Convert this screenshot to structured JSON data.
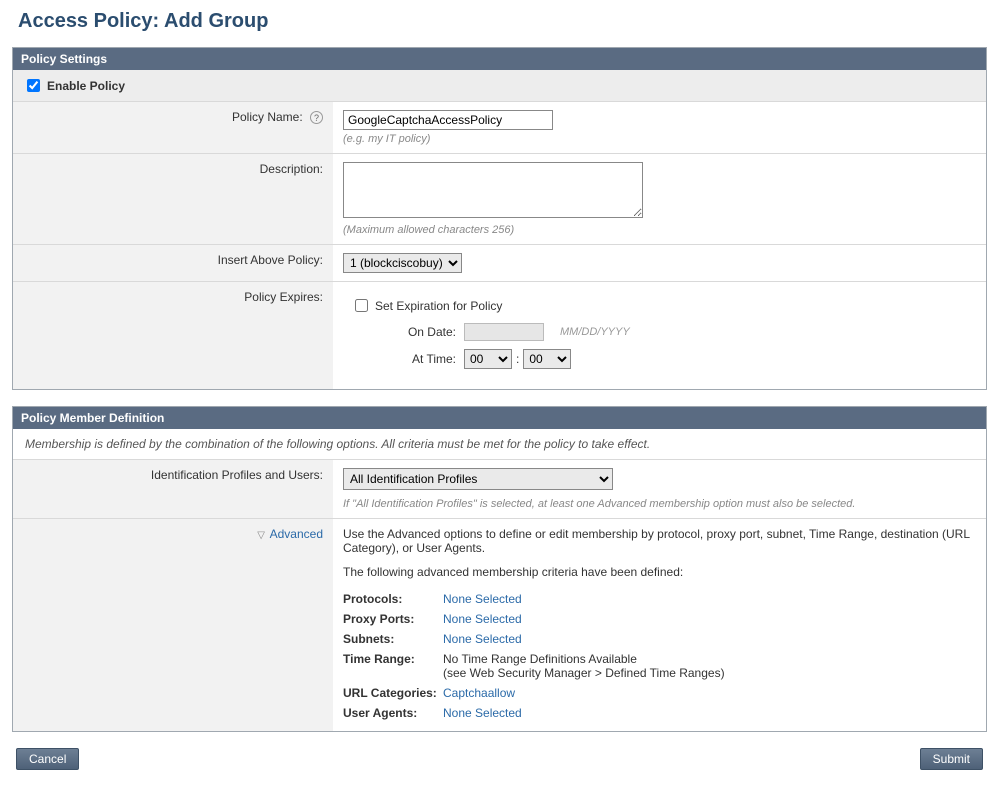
{
  "page": {
    "title": "Access Policy: Add Group"
  },
  "policySettings": {
    "header": "Policy Settings",
    "enablePolicy": {
      "label": "Enable Policy",
      "checked": true
    },
    "policyName": {
      "label": "Policy Name:",
      "value": "GoogleCaptchaAccessPolicy",
      "hint": "(e.g. my IT policy)",
      "helpText": "?"
    },
    "description": {
      "label": "Description:",
      "value": "",
      "hint": "(Maximum allowed characters 256)"
    },
    "insertAbove": {
      "label": "Insert Above Policy:",
      "selected": "1 (blockciscobuy)"
    },
    "expires": {
      "label": "Policy Expires:",
      "setExpirationLabel": "Set Expiration for Policy",
      "setExpirationChecked": false,
      "onDateLabel": "On Date:",
      "dateFormat": "MM/DD/YYYY",
      "atTimeLabel": "At Time:",
      "hour": "00",
      "minute": "00",
      "sep": ":"
    }
  },
  "policyMember": {
    "header": "Policy Member Definition",
    "note": "Membership is defined by the combination of the following options. All criteria must be met for the policy to take effect.",
    "idProfiles": {
      "label": "Identification Profiles and Users:",
      "selected": "All Identification Profiles",
      "hint": "If \"All Identification Profiles\" is selected, at least one Advanced membership option must also be selected."
    },
    "advanced": {
      "toggleLabel": "Advanced",
      "intro1": "Use the Advanced options to define or edit membership by protocol, proxy port, subnet, Time Range, destination (URL Category), or User Agents.",
      "intro2": "The following advanced membership criteria have been defined:",
      "criteria": {
        "protocolsLabel": "Protocols:",
        "protocolsValue": "None Selected",
        "proxyPortsLabel": "Proxy Ports:",
        "proxyPortsValue": "None Selected",
        "subnetsLabel": "Subnets:",
        "subnetsValue": "None Selected",
        "timeRangeLabel": "Time Range:",
        "timeRangeValue1": "No Time Range Definitions Available",
        "timeRangeValue2": "(see Web Security Manager > Defined Time Ranges)",
        "urlCatLabel": "URL Categories:",
        "urlCatValue": "Captchaallow",
        "userAgentsLabel": "User Agents:",
        "userAgentsValue": "None Selected"
      }
    }
  },
  "buttons": {
    "cancel": "Cancel",
    "submit": "Submit"
  }
}
